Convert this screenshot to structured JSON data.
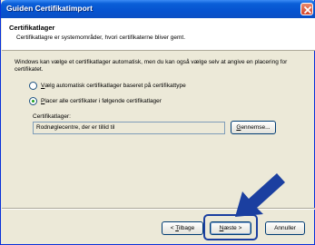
{
  "window": {
    "title": "Guiden Certifikatimport"
  },
  "header": {
    "title": "Certifikatlager",
    "subtitle": "Certifikatlagre er systemområder, hvori certifikaterne bliver gemt."
  },
  "body": {
    "description": "Windows kan vælge et certifikatlager automatisk, men du kan også vælge selv at angive en placering for certifikatet.",
    "option_auto": {
      "accel": "V",
      "rest": "ælg automatisk certifikatlager baseret på certifikattype",
      "selected": false
    },
    "option_manual": {
      "accel": "P",
      "rest": "lacer alle certifikater i følgende certifikatlager",
      "selected": true
    },
    "store_label": "Certifikatlager:",
    "store_value": "Rodnøglecentre, der er tillid til",
    "browse": {
      "accel": "G",
      "rest": "ennemse..."
    }
  },
  "buttons": {
    "back": {
      "pre": "< ",
      "accel": "T",
      "rest": "ilbage"
    },
    "next": {
      "accel": "N",
      "rest": "æste >"
    },
    "cancel": "Annuller"
  },
  "colors": {
    "titlebar": "#0653d0",
    "close": "#d4452b",
    "dialog_bg": "#ece9d8",
    "arrow": "#1b3fa0",
    "radio_dot": "#21a121"
  },
  "icons": {
    "close": "close-icon",
    "arrow": "pointer-arrow-icon"
  }
}
